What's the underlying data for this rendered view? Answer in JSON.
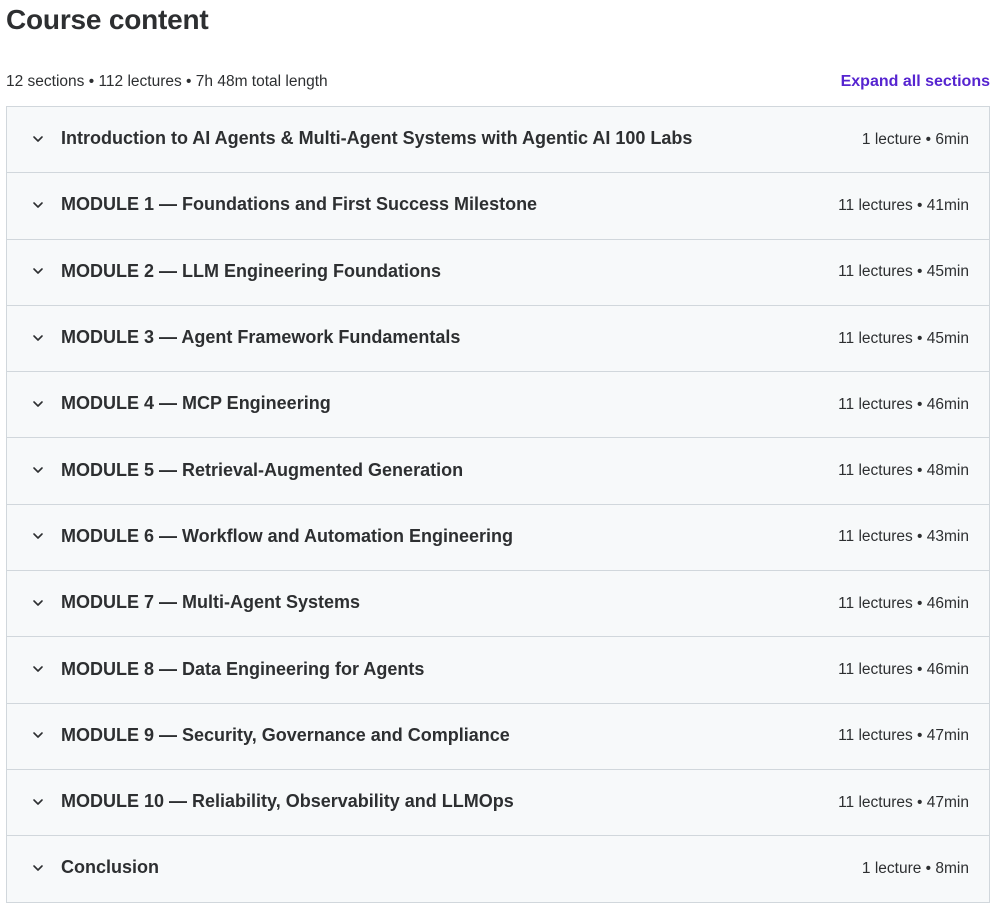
{
  "header": {
    "title": "Course content",
    "summary": "12 sections • 112 lectures • 7h 48m total length",
    "expand_label": "Expand all sections"
  },
  "colors": {
    "accent": "#5624d0",
    "row_bg": "#f7f9fa",
    "border": "#d1d7dc",
    "text": "#2d2f31"
  },
  "sections": [
    {
      "title": "Introduction to AI Agents & Multi-Agent Systems with Agentic AI 100 Labs",
      "meta": "1 lecture • 6min"
    },
    {
      "title": "MODULE 1 — Foundations and First Success Milestone",
      "meta": "11 lectures • 41min"
    },
    {
      "title": "MODULE 2 — LLM Engineering Foundations",
      "meta": "11 lectures • 45min"
    },
    {
      "title": "MODULE 3 — Agent Framework Fundamentals",
      "meta": "11 lectures • 45min"
    },
    {
      "title": "MODULE 4 — MCP Engineering",
      "meta": "11 lectures • 46min"
    },
    {
      "title": "MODULE 5 — Retrieval-Augmented Generation",
      "meta": "11 lectures • 48min"
    },
    {
      "title": "MODULE 6 — Workflow and Automation Engineering",
      "meta": "11 lectures • 43min"
    },
    {
      "title": "MODULE 7 — Multi-Agent Systems",
      "meta": "11 lectures • 46min"
    },
    {
      "title": "MODULE 8 — Data Engineering for Agents",
      "meta": "11 lectures • 46min"
    },
    {
      "title": "MODULE 9 — Security, Governance and Compliance",
      "meta": "11 lectures • 47min"
    },
    {
      "title": "MODULE 10 — Reliability, Observability and LLMOps",
      "meta": "11 lectures • 47min"
    },
    {
      "title": "Conclusion",
      "meta": "1 lecture • 8min"
    }
  ]
}
